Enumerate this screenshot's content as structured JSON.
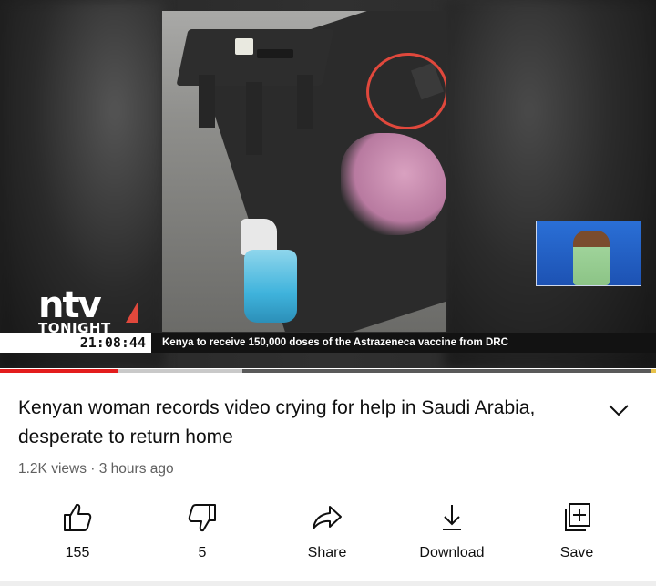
{
  "player": {
    "overlay": {
      "logo_main": "ntv",
      "logo_sub": "TONIGHT",
      "clock": "21:08:44",
      "ticker": "Kenya to receive 150,000 doses of the Astrazeneca vaccine from DRC"
    },
    "progress": {
      "played_fraction": 0.18,
      "buffered_fraction": 0.37
    }
  },
  "video": {
    "title": "Kenyan woman records video crying for help in Saudi Arabia, desperate to return home",
    "views": "1.2K views",
    "separator": "·",
    "age": "3 hours ago"
  },
  "actions": [
    {
      "icon": "thumbs-up-icon",
      "label": "155"
    },
    {
      "icon": "thumbs-down-icon",
      "label": "5"
    },
    {
      "icon": "share-icon",
      "label": "Share"
    },
    {
      "icon": "download-icon",
      "label": "Download"
    },
    {
      "icon": "save-to-playlist-icon",
      "label": "Save"
    }
  ],
  "colors": {
    "progress_played": "#e31c1c",
    "progress_buffered": "#c9c9c9",
    "text_primary": "#0f0f0f",
    "text_secondary": "#606060"
  }
}
